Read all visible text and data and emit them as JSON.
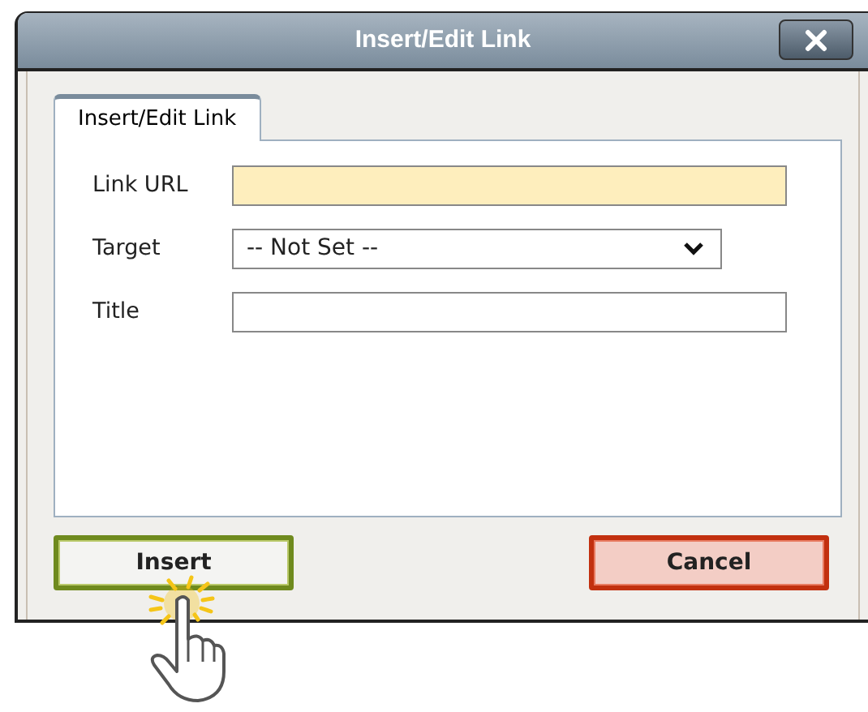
{
  "window": {
    "title": "Insert/Edit Link"
  },
  "tabs": [
    {
      "label": "Insert/Edit Link",
      "selected": true
    }
  ],
  "fields": [
    {
      "kind": "text",
      "label": "Link URL",
      "focused": true
    },
    {
      "kind": "select",
      "label": "Target",
      "value": "-- Not Set --",
      "focused": false
    },
    {
      "kind": "text",
      "label": "Title",
      "focused": false
    }
  ],
  "buttons": [
    {
      "kind": "confirm",
      "label": "Insert"
    },
    {
      "kind": "cancel",
      "label": "Cancel"
    }
  ]
}
